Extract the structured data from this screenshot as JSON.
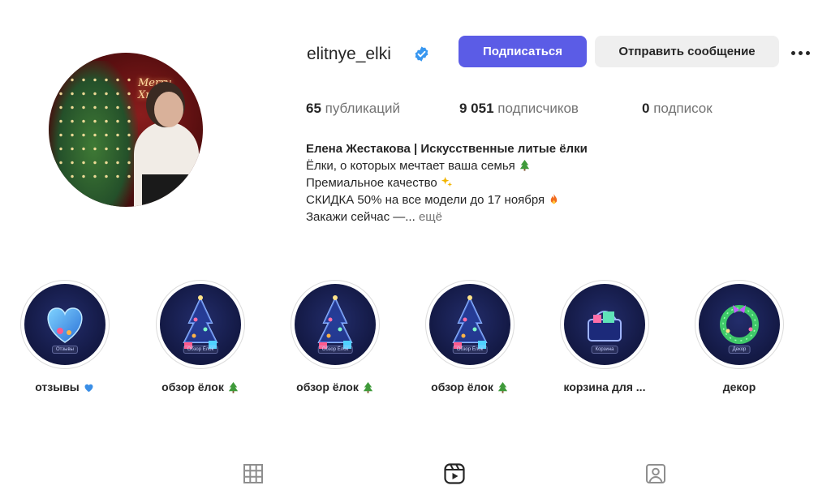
{
  "profile": {
    "username": "elitnye_elki",
    "verified": true,
    "follow_label": "Подписаться",
    "message_label": "Отправить сообщение",
    "more_icon": "more-horizontal-icon"
  },
  "stats": {
    "posts_count": "65",
    "posts_label": "публикаций",
    "followers_count": "9 051",
    "followers_label": "подписчиков",
    "following_count": "0",
    "following_label": "подписок"
  },
  "bio": {
    "name": "Елена Жестакова | Искусственные литые ёлки",
    "line1": "Ёлки, о которых мечтает ваша семья",
    "line2": "Премиальное качество",
    "line3": "СКИДКА 50% на все модели до 17 ноября",
    "line4": "Закажи сейчас —...",
    "more": "ещё"
  },
  "highlights": [
    {
      "label": "отзывы",
      "cover_text": "Отзывы",
      "icon": "heart-icon"
    },
    {
      "label": "обзор ёлок",
      "cover_text": "Обзор Ёлок",
      "icon": "tree-icon"
    },
    {
      "label": "обзор ёлок",
      "cover_text": "Обзор Ёлок",
      "icon": "tree-icon"
    },
    {
      "label": "обзор ёлок",
      "cover_text": "Обзор Ёлок",
      "icon": "tree-icon"
    },
    {
      "label": "корзина для ...",
      "cover_text": "Корзина",
      "icon": "basket-icon"
    },
    {
      "label": "декор",
      "cover_text": "Декор",
      "icon": "wreath-icon"
    }
  ],
  "tabs": [
    {
      "icon": "grid-icon"
    },
    {
      "icon": "reels-icon"
    },
    {
      "icon": "tagged-icon"
    }
  ],
  "colors": {
    "follow_button": "#5b5ce6",
    "message_button": "#efefef",
    "verified_badge": "#3897f0",
    "highlight_bg": "#141a46"
  }
}
